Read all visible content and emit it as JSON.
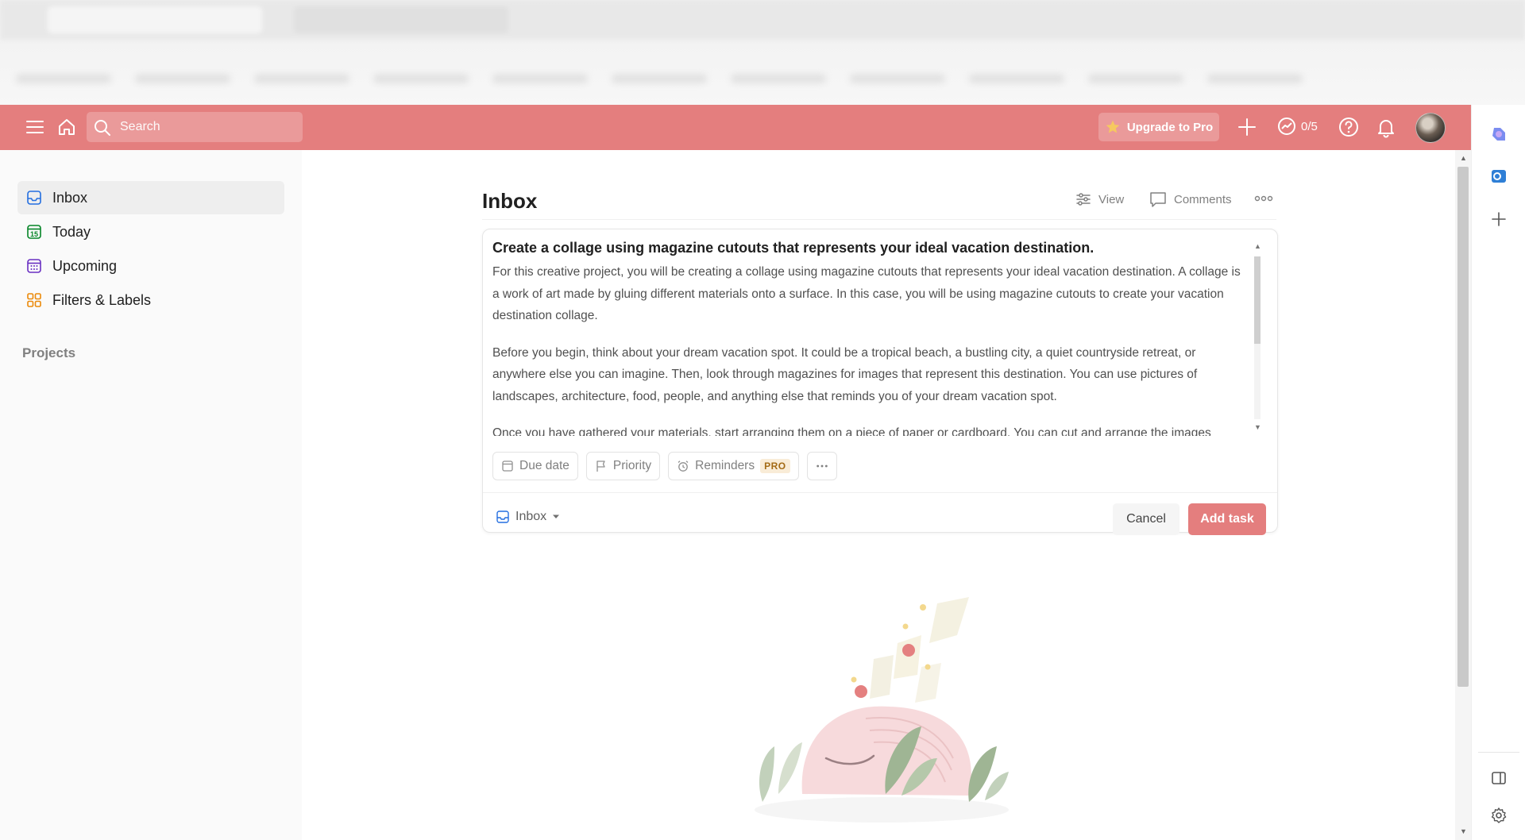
{
  "topbar": {
    "search_placeholder": "Search",
    "upgrade_label": "Upgrade to Pro",
    "karma_progress": "0/5"
  },
  "sidebar": {
    "items": [
      {
        "label": "Inbox",
        "icon": "inbox-icon",
        "active": true
      },
      {
        "label": "Today",
        "icon": "calendar-today-icon",
        "date_number": "15"
      },
      {
        "label": "Upcoming",
        "icon": "calendar-grid-icon"
      },
      {
        "label": "Filters & Labels",
        "icon": "grid-icon"
      }
    ],
    "projects_label": "Projects"
  },
  "main": {
    "title": "Inbox",
    "view_label": "View",
    "comments_label": "Comments"
  },
  "editor": {
    "task_title": "Create a collage using magazine cutouts that represents your ideal vacation destination.",
    "description": [
      "For this creative project, you will be creating a collage using magazine cutouts that represents your ideal vacation destination. A collage is a work of art made by gluing different materials onto a surface. In this case, you will be using magazine cutouts to create your vacation destination collage.",
      "Before you begin, think about your dream vacation spot. It could be a tropical beach, a bustling city, a quiet countryside retreat, or anywhere else you can imagine. Then, look through magazines for images that represent this destination. You can use pictures of landscapes, architecture, food, people, and anything else that reminds you of your dream vacation spot.",
      "Once you have gathered your materials, start arranging them on a piece of paper or cardboard. You can cut and arrange the images"
    ],
    "due_date_label": "Due date",
    "priority_label": "Priority",
    "reminders_label": "Reminders",
    "pro_badge": "PRO",
    "project_label": "Inbox",
    "cancel_label": "Cancel",
    "add_task_label": "Add task"
  },
  "colors": {
    "accent": "#e47e7e",
    "pro_badge_bg": "#f9ecd7",
    "pro_badge_text": "#a36a14"
  }
}
